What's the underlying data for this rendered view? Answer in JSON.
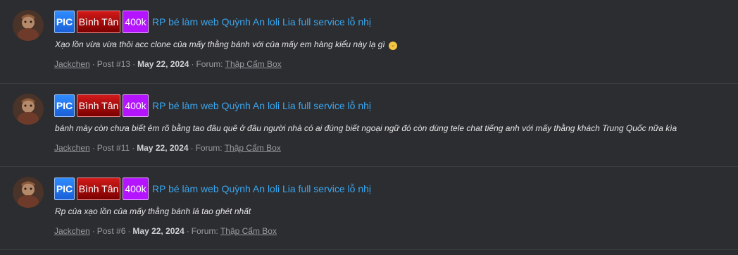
{
  "posts": [
    {
      "badges": {
        "pic": "PIC",
        "area": "Bình Tân",
        "price": "400k"
      },
      "title": "RP bé làm web Quỳnh An loli Lia full service lỗ nhị",
      "snippet": "Xạo lồn vừa vừa thôi acc clone của mấy thằng bánh với của mấy em hàng kiểu này lạ gì",
      "snippet_emoji": "smiling-face-icon",
      "author": "Jackchen",
      "post_number": "Post #13",
      "date": "May 22, 2024",
      "forum_label": "Forum:",
      "forum": "Thập Cẩm Box"
    },
    {
      "badges": {
        "pic": "PIC",
        "area": "Bình Tân",
        "price": "400k"
      },
      "title": "RP bé làm web Quỳnh An loli Lia full service lỗ nhị",
      "snippet": "bánh mày còn chưa biết ẻm rõ bằng tao đâu quê ở đâu người nhà có ai đúng biết ngoại ngữ đó còn dùng tele chat tiếng anh với mấy thằng khách Trung Quốc nữa kìa",
      "author": "Jackchen",
      "post_number": "Post #11",
      "date": "May 22, 2024",
      "forum_label": "Forum:",
      "forum": "Thập Cẩm Box"
    },
    {
      "badges": {
        "pic": "PIC",
        "area": "Bình Tân",
        "price": "400k"
      },
      "title": "RP bé làm web Quỳnh An loli Lia full service lỗ nhị",
      "snippet": "Rp của xạo lồn của mấy thằng bánh lá tao ghét nhất",
      "author": "Jackchen",
      "post_number": "Post #6",
      "date": "May 22, 2024",
      "forum_label": "Forum:",
      "forum": "Thập Cẩm Box"
    }
  ],
  "colors": {
    "background": "#2c2d31",
    "title_link": "#3aa7ef",
    "pic_badge": "#2f8cff",
    "area_badge": "#b51010",
    "price_badge": "#b414ff"
  }
}
